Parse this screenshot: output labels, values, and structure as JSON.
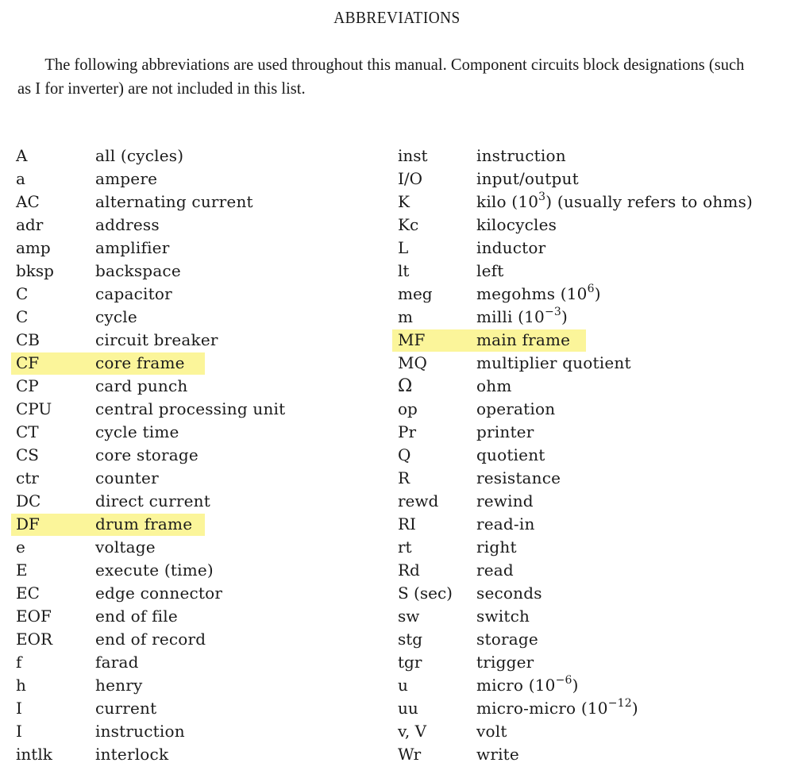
{
  "page": {
    "title": "ABBREVIATIONS",
    "intro": "The following abbreviations are used throughout this manual.  Component circuits block designations (such as I for inverter) are not included in this list.",
    "highlight_color": "#fbf59a"
  },
  "left_column": [
    {
      "abbr": "A",
      "def": "all (cycles)"
    },
    {
      "abbr": "a",
      "def": "ampere"
    },
    {
      "abbr": "AC",
      "def": "alternating current"
    },
    {
      "abbr": "adr",
      "def": "address"
    },
    {
      "abbr": "amp",
      "def": "amplifier"
    },
    {
      "abbr": "bksp",
      "def": "backspace"
    },
    {
      "abbr": "C",
      "def": "capacitor"
    },
    {
      "abbr": "C",
      "def": "cycle"
    },
    {
      "abbr": "CB",
      "def": "circuit breaker"
    },
    {
      "abbr": "CF",
      "def": "core frame",
      "highlighted": true
    },
    {
      "abbr": "CP",
      "def": "card punch"
    },
    {
      "abbr": "CPU",
      "def": "central processing unit"
    },
    {
      "abbr": "CT",
      "def": "cycle time"
    },
    {
      "abbr": "CS",
      "def": "core storage"
    },
    {
      "abbr": "ctr",
      "def": "counter"
    },
    {
      "abbr": "DC",
      "def": "direct current"
    },
    {
      "abbr": "DF",
      "def": "drum frame",
      "highlighted": true
    },
    {
      "abbr": "e",
      "def": "voltage"
    },
    {
      "abbr": "E",
      "def": "execute (time)"
    },
    {
      "abbr": "EC",
      "def": "edge connector"
    },
    {
      "abbr": "EOF",
      "def": "end of file"
    },
    {
      "abbr": "EOR",
      "def": "end of record"
    },
    {
      "abbr": "f",
      "def": "farad"
    },
    {
      "abbr": "h",
      "def": "henry"
    },
    {
      "abbr": "I",
      "def": "current"
    },
    {
      "abbr": "I",
      "def": "instruction"
    },
    {
      "abbr": "intlk",
      "def": "interlock"
    }
  ],
  "right_column": [
    {
      "abbr": "inst",
      "def": "instruction"
    },
    {
      "abbr": "I/O",
      "def": "input/output"
    },
    {
      "abbr": "K",
      "def": "kilo (10",
      "sup": "3",
      "def_after": ") (usually refers to ohms)"
    },
    {
      "abbr": "Kc",
      "def": "kilocycles"
    },
    {
      "abbr": "L",
      "def": "inductor"
    },
    {
      "abbr": "lt",
      "def": "left"
    },
    {
      "abbr": "meg",
      "def": "megohms (10",
      "sup": "6",
      "def_after": ")"
    },
    {
      "abbr": "m",
      "def": "milli (10",
      "sup": "−3",
      "def_after": ")"
    },
    {
      "abbr": "MF",
      "def": "main frame",
      "highlighted": true
    },
    {
      "abbr": "MQ",
      "def": "multiplier quotient"
    },
    {
      "abbr": "Ω",
      "abbr_icon": "ohm-symbol-icon",
      "def": "ohm"
    },
    {
      "abbr": "op",
      "def": "operation"
    },
    {
      "abbr": "Pr",
      "def": "printer"
    },
    {
      "abbr": "Q",
      "def": "quotient"
    },
    {
      "abbr": "R",
      "def": "resistance"
    },
    {
      "abbr": "rewd",
      "def": "rewind"
    },
    {
      "abbr": "RI",
      "def": "read-in"
    },
    {
      "abbr": "rt",
      "def": "right"
    },
    {
      "abbr": "Rd",
      "def": "read"
    },
    {
      "abbr": "S (sec)",
      "def": "seconds"
    },
    {
      "abbr": "sw",
      "def": "switch"
    },
    {
      "abbr": "stg",
      "def": "storage"
    },
    {
      "abbr": "tgr",
      "def": "trigger"
    },
    {
      "abbr": "u",
      "def": "micro (10",
      "sup": "−6",
      "def_after": ")"
    },
    {
      "abbr": "uu",
      "def": "micro-micro (10",
      "sup": "−12",
      "def_after": ")"
    },
    {
      "abbr": "v, V",
      "def": "volt"
    },
    {
      "abbr": "Wr",
      "def": "write"
    }
  ]
}
